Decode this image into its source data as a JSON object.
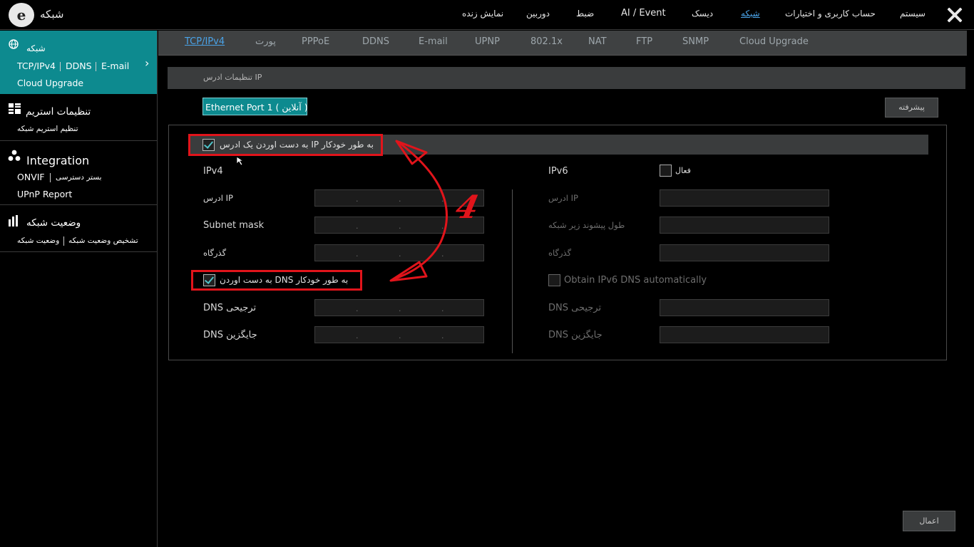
{
  "header": {
    "logo_letter": "e",
    "title": "شبکه",
    "nav": [
      "سیستم",
      "حساب کاربری و اختیارات",
      "شبکه",
      "دیسک",
      "AI / Event",
      "ضبط",
      "دوربین",
      "نمایش زنده"
    ],
    "active_nav": "شبکه"
  },
  "sidebar": {
    "network": {
      "icon": "globe-icon",
      "title": "شبکه",
      "links": [
        "TCP/IPv4",
        "DDNS",
        "E-mail",
        "Cloud Upgrade"
      ]
    },
    "stream": {
      "icon": "grid-icon",
      "title": "تنظیمات استریم",
      "links": [
        "تنظیم استریم شبکه"
      ]
    },
    "integration": {
      "icon": "integration-icon",
      "title": "Integration",
      "links": [
        "ONVIF",
        "بستر دسترسی",
        "UPnP Report"
      ]
    },
    "status": {
      "icon": "status-icon",
      "title": "وضعیت شبکه",
      "links": [
        "تشخیص وضعیت شبکه",
        "وضعیت شبکه"
      ]
    }
  },
  "tabs": [
    "TCP/IPv4",
    "پورت",
    "PPPoE",
    "DDNS",
    "E-mail",
    "UPNP",
    "802.1x",
    "NAT",
    "FTP",
    "SNMP",
    "Cloud Upgrade"
  ],
  "active_tab": "TCP/IPv4",
  "section_header": "تنظیمات ادرس IP",
  "port_button": "Ethernet Port 1 ( آنلاین )",
  "advanced_button": "پیشرفته",
  "auto_ip": {
    "label": "به دست اوردن یک ادرس IP به طور خودکار",
    "checked": true
  },
  "ipv4": {
    "title": "IPv4",
    "ip_label": "ادرس IP",
    "subnet_label": "Subnet mask",
    "gateway_label": "گذرگاه",
    "auto_dns_label": "به دست اوردن DNS  به طور خودکار",
    "auto_dns_checked": true,
    "preferred_dns_label": "DNS ترجیحی",
    "alternate_dns_label": "DNS جایگزین"
  },
  "ipv6": {
    "title": "IPv6",
    "enable_label": "فعال",
    "enabled": false,
    "ip_label": "ادرس IP",
    "prefix_label": "طول پیشوند زیر شبکه",
    "gateway_label": "گذرگاه",
    "auto_dns_label": "Obtain IPv6 DNS automatically",
    "preferred_dns_label": "DNS ترجیحی",
    "alternate_dns_label": "DNS جایگزین"
  },
  "annotation": {
    "step_number": "4",
    "color": "#e1141b"
  },
  "apply_button": "اعمال"
}
